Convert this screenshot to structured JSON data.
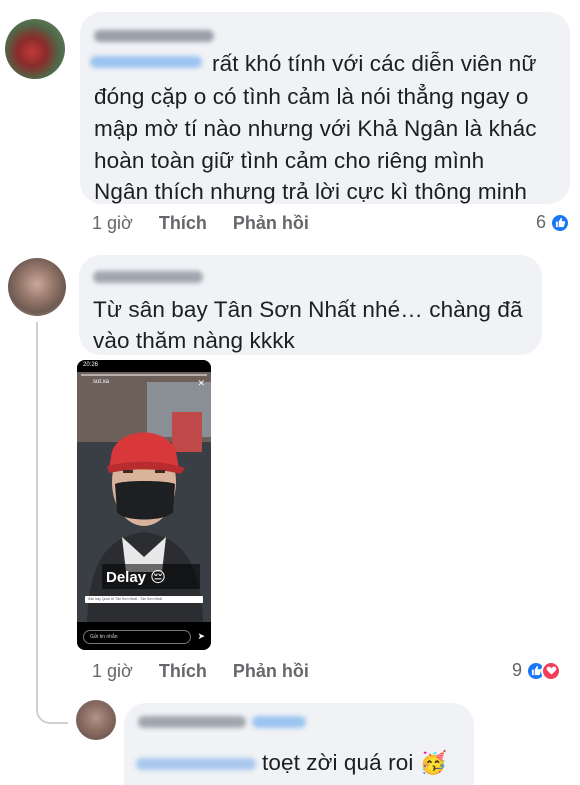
{
  "comments": [
    {
      "text_lines": [
        "rất khó tính với các diễn viên nữ",
        "đóng cặp o có tình cảm là nói thẳng ngay o",
        "mập mờ tí nào nhưng với Khả Ngân là khác",
        "hoàn toàn giữ tình cảm cho riêng mình",
        "Ngân thích nhưng trả lời cực kì thông minh"
      ],
      "time": "1 giờ",
      "like_label": "Thích",
      "reply_label": "Phản hồi",
      "reaction_count": "6",
      "reactions": [
        "like-icon"
      ]
    },
    {
      "text_lines": [
        "Từ sân bay Tân Sơn Nhất nhé… chàng đã",
        "vào thăm nàng kkkk"
      ],
      "time": "1 giờ",
      "like_label": "Thích",
      "reply_label": "Phản hồi",
      "reaction_count": "9",
      "reactions": [
        "like-icon",
        "love-icon"
      ],
      "attachment": {
        "status_time": "20:26",
        "user": "sut.xa",
        "sticker_text": "Delay",
        "location_text": "Sân bay Quốc tế Tân Sơn Nhất - Tân Sơn Nhất",
        "reply_placeholder": "Gửi tin nhắn"
      }
    },
    {
      "text_lines": [
        "toẹt zời quá roi"
      ],
      "emoji": "🥳"
    }
  ],
  "colors": {
    "bubble": "#f0f2f5",
    "like_blue": "#1877f2",
    "love_red": "#f33e58",
    "meta_gray": "#65676b"
  }
}
